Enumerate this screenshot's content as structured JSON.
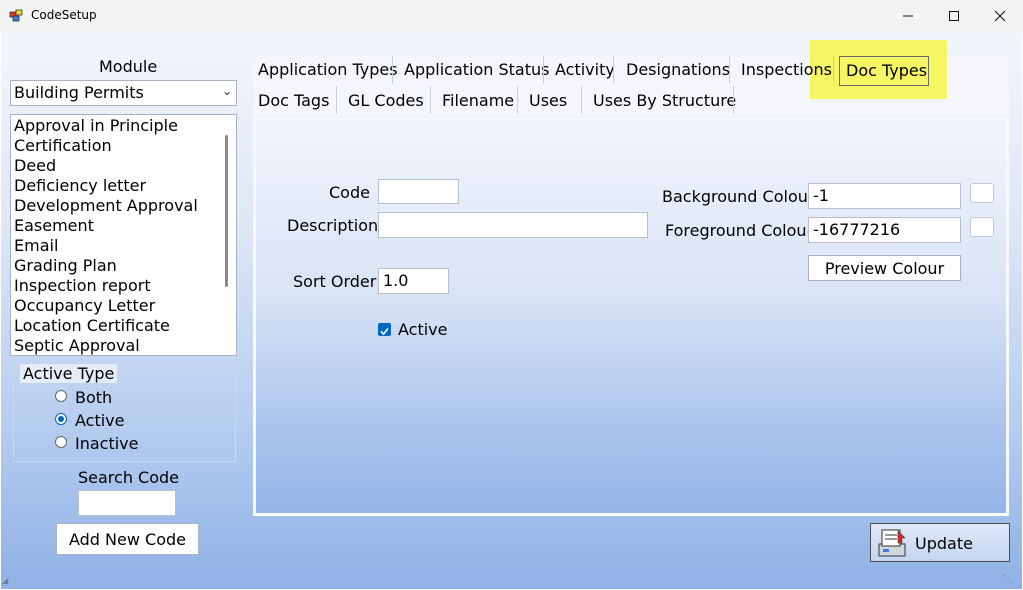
{
  "window": {
    "title": "CodeSetup",
    "minimize_icon": "minimize-icon",
    "maximize_icon": "maximize-icon",
    "close_icon": "close-icon"
  },
  "left": {
    "module_label": "Module",
    "module_value": "Building Permits",
    "codes": [
      "Approval in Principle",
      "Certification",
      "Deed",
      "Deficiency letter",
      "Development Approval",
      "Easement",
      "Email",
      "Grading Plan",
      "Inspection report",
      "Occupancy Letter",
      "Location Certificate",
      "Septic Approval"
    ],
    "active_type_label": "Active Type",
    "radios": [
      {
        "label": "Both",
        "checked": false
      },
      {
        "label": "Active",
        "checked": true
      },
      {
        "label": "Inactive",
        "checked": false
      }
    ],
    "search_label": "Search Code",
    "search_value": "",
    "add_button": "Add New Code"
  },
  "tabs": {
    "row1": [
      "Application Types",
      "Application Status",
      "Activity",
      "Designations",
      "Inspections",
      "Doc Types"
    ],
    "row2": [
      "Doc Tags",
      "GL Codes",
      "Filename",
      "Uses",
      "Uses By Structure"
    ],
    "selected": "Doc Types"
  },
  "form": {
    "code_label": "Code",
    "code_value": "",
    "description_label": "Description",
    "description_value": "",
    "sort_order_label": "Sort Order",
    "sort_order_value": "1.0",
    "active_label": "Active",
    "active_checked": true,
    "bg_colour_label": "Background Colour",
    "bg_colour_value": "-1",
    "fg_colour_label": "Foreground Colour",
    "fg_colour_value": "-16777216",
    "preview_button": "Preview Colour",
    "update_button": "Update"
  },
  "colors": {
    "highlight": "#f6f553",
    "accent": "#0067c0"
  }
}
